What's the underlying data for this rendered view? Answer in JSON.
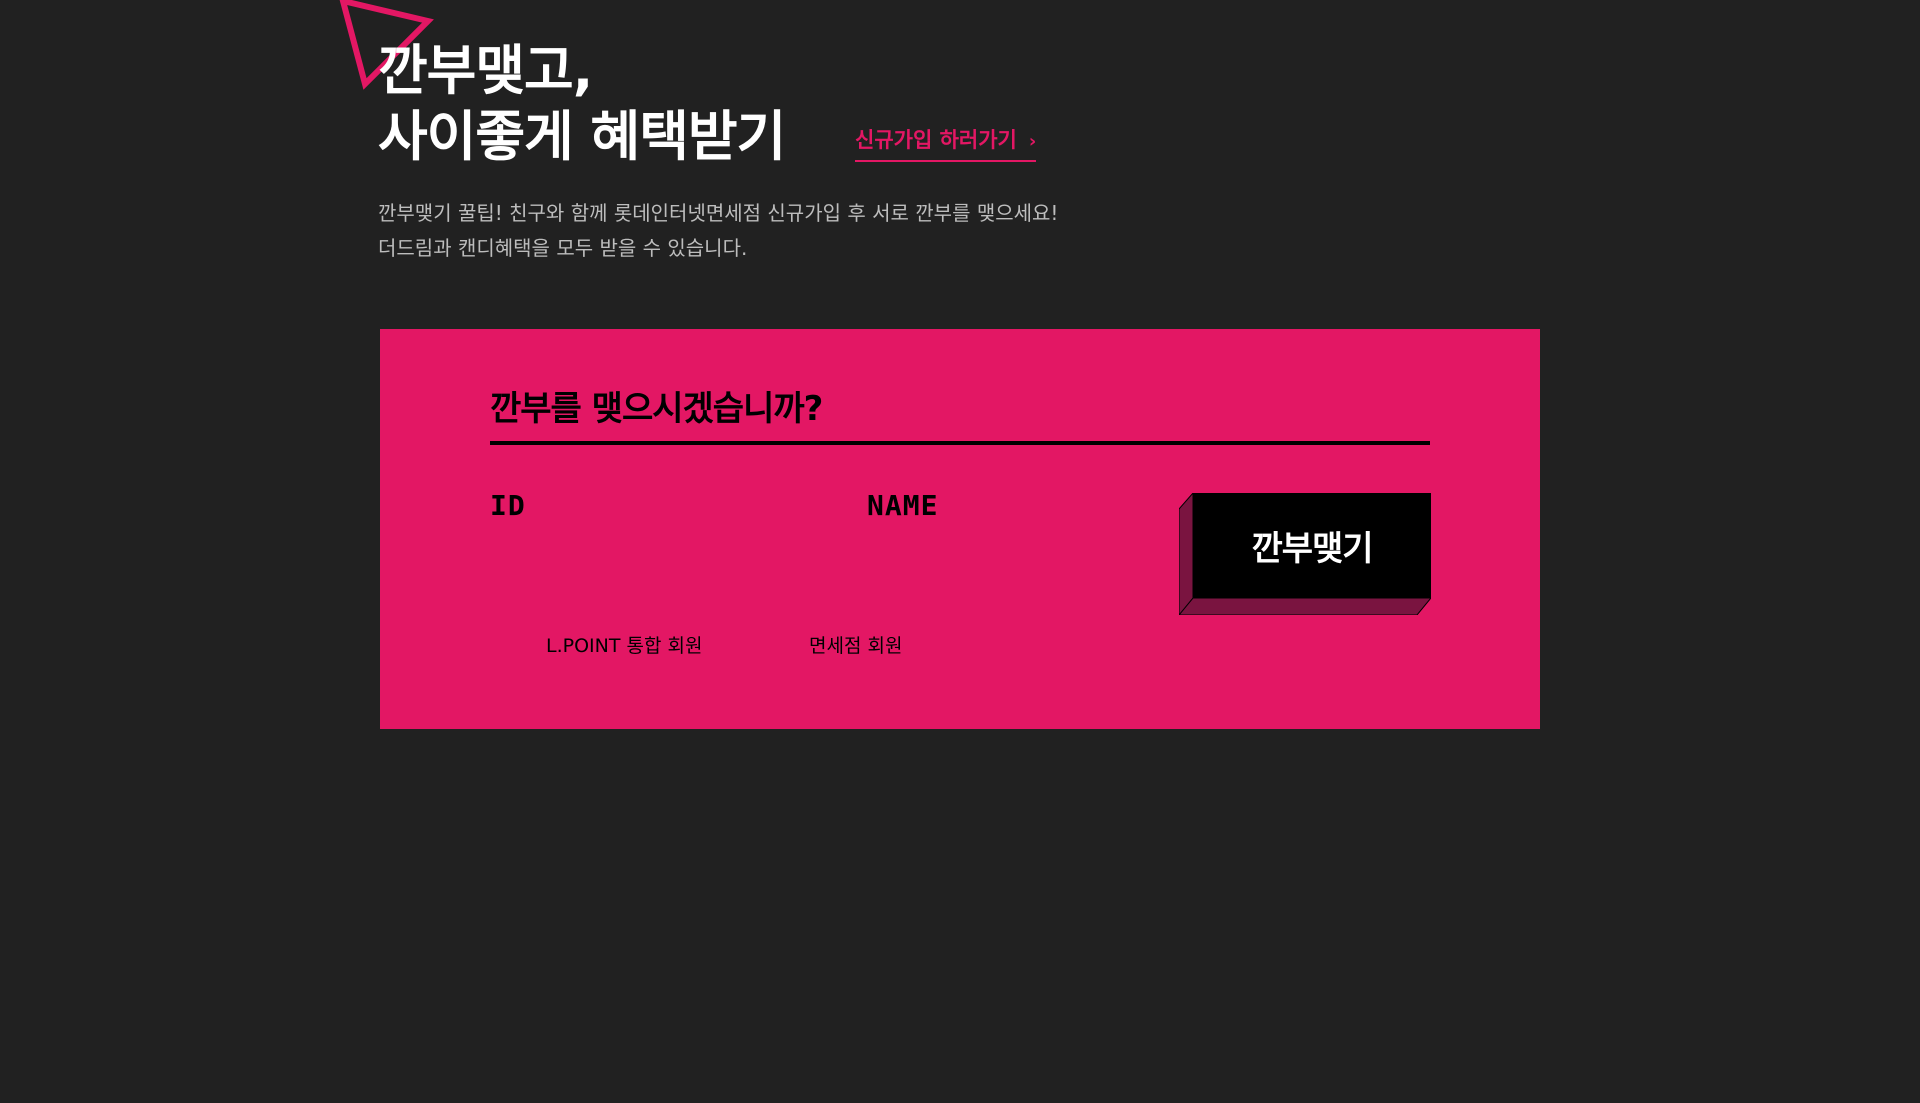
{
  "hero": {
    "title_line1": "깐부맺고,",
    "title_line2": "사이좋게 혜택받기",
    "signup_link": "신규가입 하러가기",
    "signup_chevron": "›",
    "desc_line1": "깐부맺기 꿀팁!  친구와 함께 롯데인터넷면세점 신규가입 후 서로 깐부를 맺으세요!",
    "desc_line2": "더드림과 캔디혜택을 모두 받을 수 있습니다."
  },
  "form": {
    "title": "깐부를 맺으시겠습니까?",
    "id_label": "ID",
    "name_label": "NAME",
    "id_value": "",
    "name_value": "",
    "member_types": [
      {
        "label": "L.POINT 통합 회원"
      },
      {
        "label": "면세점 회원"
      }
    ],
    "submit_label": "깐부맺기"
  },
  "colors": {
    "background": "#212121",
    "accent": "#e31764",
    "button": "#000000",
    "button_shadow": "#7a1440"
  },
  "icons": {
    "corner_triangle": "triangle-outline-icon",
    "signup_chevron": "chevron-right-icon"
  }
}
